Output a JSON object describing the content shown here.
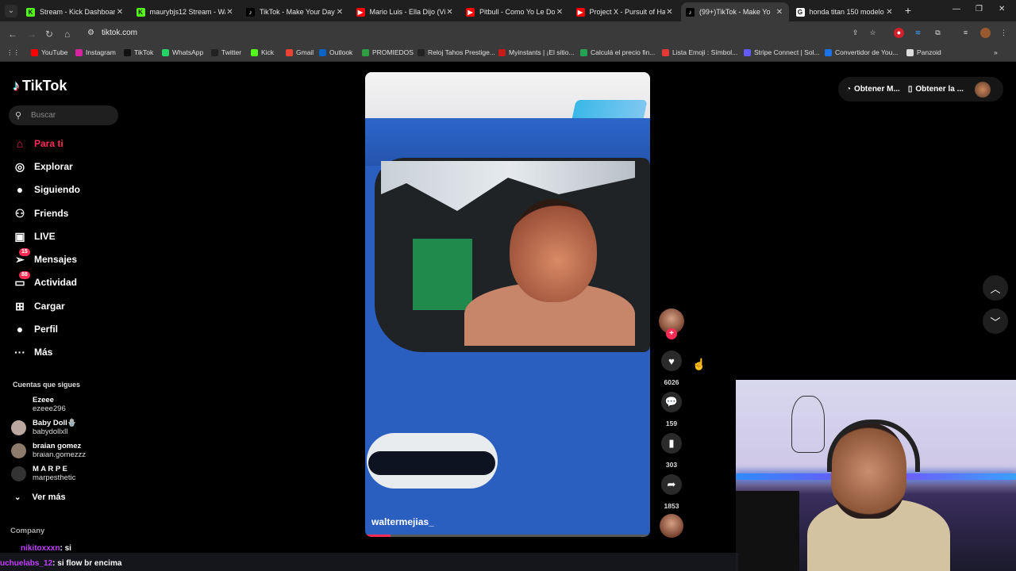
{
  "browser": {
    "tabs": [
      {
        "title": "Stream - Kick Dashboard",
        "fav_color": "#53fc18",
        "fav_glyph": "K"
      },
      {
        "title": "maurybjs12 Stream - Wat",
        "fav_color": "#53fc18",
        "fav_glyph": "K"
      },
      {
        "title": "TikTok - Make Your Day",
        "fav_color": "#000000",
        "fav_glyph": "♪"
      },
      {
        "title": "Mario Luis - Ella Dijo (Vid",
        "fav_color": "#ff0000",
        "fav_glyph": "▶"
      },
      {
        "title": "Pitbull - Como Yo Le Doy",
        "fav_color": "#ff0000",
        "fav_glyph": "▶"
      },
      {
        "title": "Project X - Pursuit of Hap",
        "fav_color": "#ff0000",
        "fav_glyph": "▶"
      },
      {
        "title": "(99+)TikTok - Make Yo",
        "fav_color": "#000000",
        "fav_glyph": "♪"
      },
      {
        "title": "honda titan 150 modelo",
        "fav_color": "#ffffff",
        "fav_glyph": "G"
      }
    ],
    "active_tab_index": 6,
    "url": "tiktok.com",
    "bookmarks": [
      {
        "label": "YouTube",
        "color": "#ff0000"
      },
      {
        "label": "Instagram",
        "color": "#d6249f"
      },
      {
        "label": "TikTok",
        "color": "#111111"
      },
      {
        "label": "WhatsApp",
        "color": "#25d366"
      },
      {
        "label": "Twitter",
        "color": "#222222"
      },
      {
        "label": "Kick",
        "color": "#53fc18"
      },
      {
        "label": "Gmail",
        "color": "#ea4335"
      },
      {
        "label": "Outlook",
        "color": "#0a64c8"
      },
      {
        "label": "PROMIEDOS",
        "color": "#2ea043"
      },
      {
        "label": "Reloj Tahos Prestige...",
        "color": "#222222"
      },
      {
        "label": "Myinstants | ¡El sitio...",
        "color": "#c91a1a"
      },
      {
        "label": "Calculá el precio fin...",
        "color": "#23a455"
      },
      {
        "label": "Lista Emoji : Símbol...",
        "color": "#e53935"
      },
      {
        "label": "Stripe Connect | Sol...",
        "color": "#635bff"
      },
      {
        "label": "Convertidor de You...",
        "color": "#1a73e8"
      },
      {
        "label": "Panzoid",
        "color": "#dddddd"
      }
    ]
  },
  "tiktok": {
    "logo": "TikTok",
    "search_placeholder": "Buscar",
    "nav": [
      {
        "label": "Para ti",
        "icon": "home-icon",
        "glyph": "⌂",
        "active": true
      },
      {
        "label": "Explorar",
        "icon": "compass-icon",
        "glyph": "◎"
      },
      {
        "label": "Siguiendo",
        "icon": "following-avatar-icon",
        "glyph": "●"
      },
      {
        "label": "Friends",
        "icon": "friends-icon",
        "glyph": "⚇"
      },
      {
        "label": "LIVE",
        "icon": "live-icon",
        "glyph": "▣"
      },
      {
        "label": "Mensajes",
        "icon": "messages-icon",
        "glyph": "➢",
        "badge": "15"
      },
      {
        "label": "Actividad",
        "icon": "activity-icon",
        "glyph": "▭",
        "badge": "88"
      },
      {
        "label": "Cargar",
        "icon": "upload-icon",
        "glyph": "⊞"
      },
      {
        "label": "Perfil",
        "icon": "profile-icon",
        "glyph": "●"
      },
      {
        "label": "Más",
        "icon": "more-icon",
        "glyph": "···"
      }
    ],
    "following_title": "Cuentas que sigues",
    "following": [
      {
        "name": "Ezeee",
        "handle": "ezeee296",
        "color": "#000000"
      },
      {
        "name": "Baby Doll🪬",
        "handle": "babydollxll",
        "color": "#b9a7a0"
      },
      {
        "name": "braian gomez",
        "handle": "braian.gomezzz",
        "color": "#8c7a6a"
      },
      {
        "name": "M A R P E",
        "handle": "marpesthetic",
        "color": "#333333"
      }
    ],
    "see_more": "Ver más",
    "company": "Company",
    "video": {
      "author": "waltermejias_",
      "progress": 0.09
    },
    "actions": {
      "likes": "6026",
      "comments": "159",
      "saves": "303",
      "shares": "1853"
    },
    "top_right": {
      "coins_label": "Obtener M...",
      "app_label": "Obtener la ..."
    }
  },
  "stream_overlay": {
    "chat": [
      {
        "user": "nikitoxxxn",
        "message": ": si"
      },
      {
        "user": "uchuelabs_12",
        "message": ": si flow br encima"
      }
    ]
  }
}
